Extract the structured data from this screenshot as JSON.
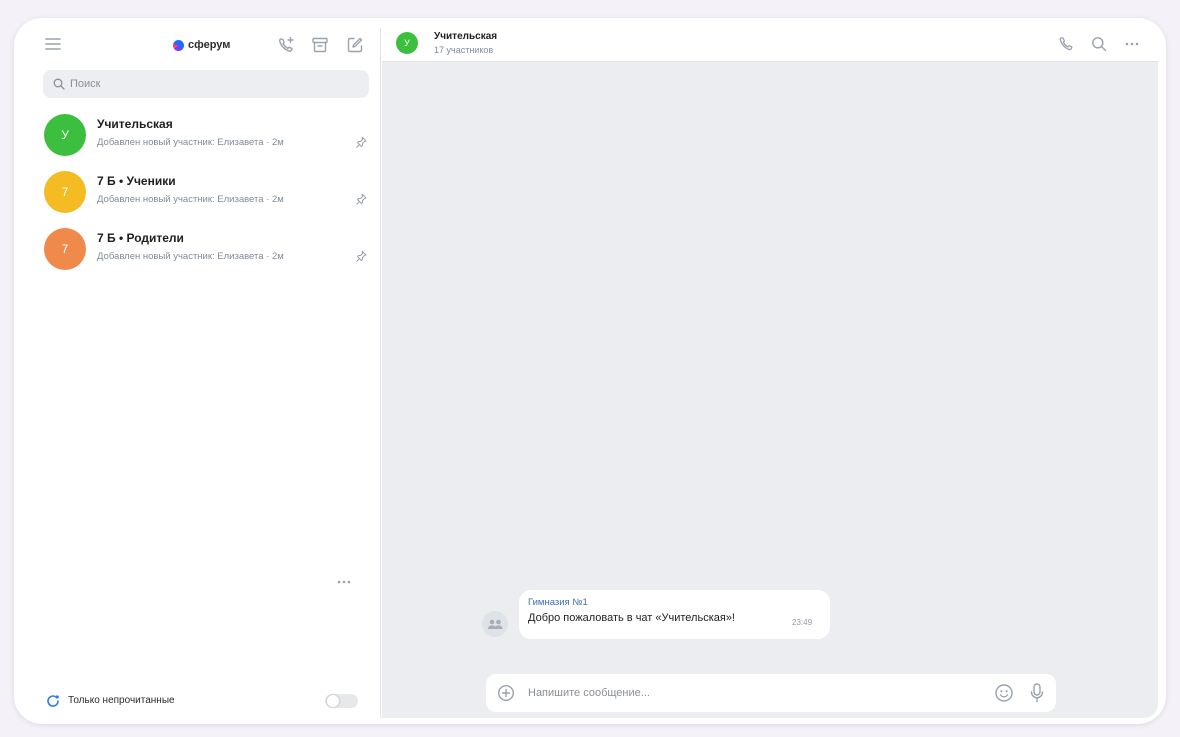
{
  "app": {
    "logo_text": "сферум"
  },
  "sidebar": {
    "search_placeholder": "Поиск",
    "chats": [
      {
        "avatar_letter": "У",
        "avatar_color": "#3cbf3f",
        "name": "Учительская",
        "preview": "Добавлен новый участник: Елизавета · 2м",
        "pinned": true
      },
      {
        "avatar_letter": "7",
        "avatar_color": "#f4bb22",
        "name": "7 Б • Ученики",
        "preview": "Добавлен новый участник: Елизавета · 2м",
        "pinned": true
      },
      {
        "avatar_letter": "7",
        "avatar_color": "#f08a4b",
        "name": "7 Б • Родители",
        "preview": "Добавлен новый участник: Елизавета · 2м",
        "pinned": true
      }
    ],
    "unread_only_label": "Только непрочитанные",
    "unread_only_enabled": false
  },
  "chat": {
    "avatar_letter": "У",
    "avatar_color": "#3cbf3f",
    "title": "Учительская",
    "subtitle": "17 участников",
    "messages": [
      {
        "sender": "Гимназия №1",
        "text": "Добро пожаловать в чат «Учительская»!",
        "time": "23:49"
      }
    ],
    "composer_placeholder": "Напишите сообщение..."
  },
  "colors": {
    "accent": "#2d81e0",
    "chat_background": "#ebedf0",
    "icon_gray": "#99a2ad"
  }
}
